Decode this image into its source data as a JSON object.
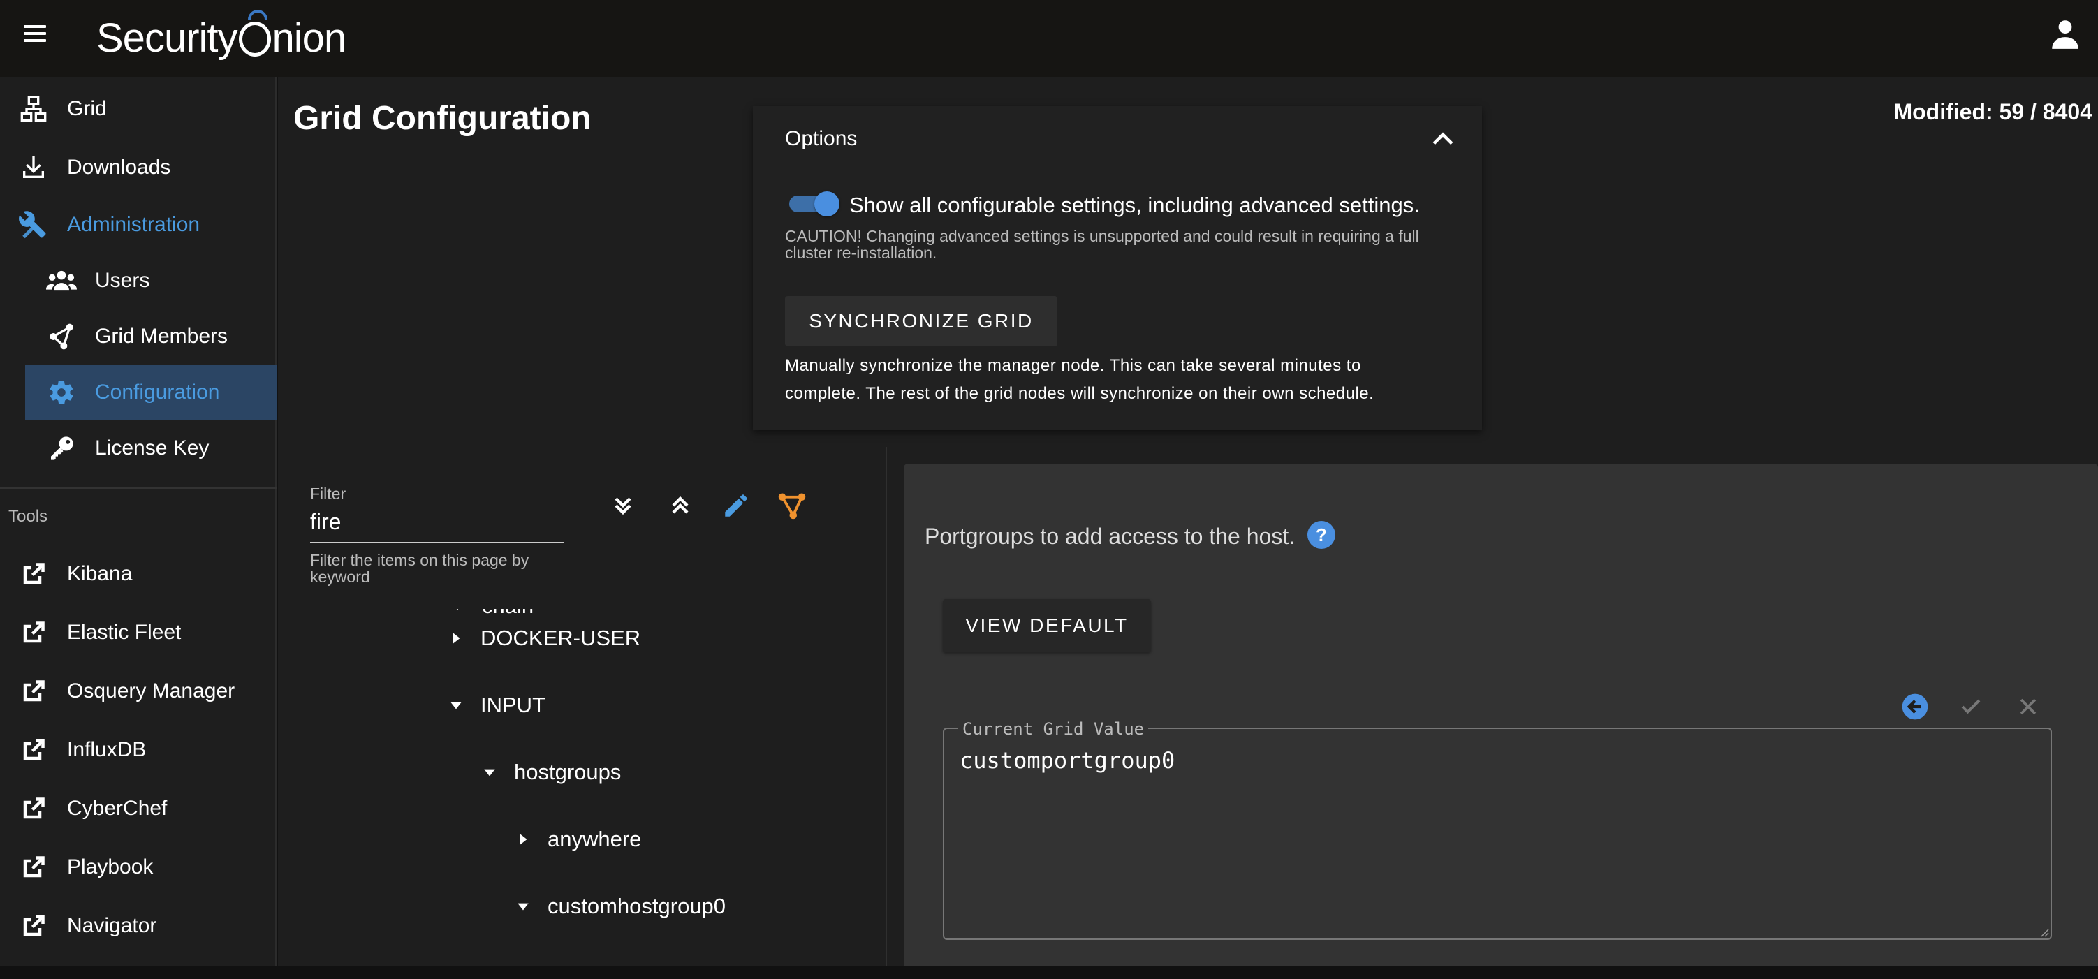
{
  "app": {
    "logo_text_a": "Security",
    "logo_text_b": "nion"
  },
  "sidebar": {
    "items": [
      {
        "label": "Grid",
        "icon": "network-icon"
      },
      {
        "label": "Downloads",
        "icon": "download-icon"
      },
      {
        "label": "Administration",
        "icon": "tools-icon"
      },
      {
        "label": "Users",
        "icon": "users-icon"
      },
      {
        "label": "Grid Members",
        "icon": "grid-members-icon"
      },
      {
        "label": "Configuration",
        "icon": "gear-icon"
      },
      {
        "label": "License Key",
        "icon": "key-icon"
      }
    ],
    "tools_label": "Tools",
    "tools": [
      {
        "label": "Kibana",
        "icon": "external-link-icon"
      },
      {
        "label": "Elastic Fleet",
        "icon": "external-link-icon"
      },
      {
        "label": "Osquery Manager",
        "icon": "external-link-icon"
      },
      {
        "label": "InfluxDB",
        "icon": "external-link-icon"
      },
      {
        "label": "CyberChef",
        "icon": "external-link-icon"
      },
      {
        "label": "Playbook",
        "icon": "external-link-icon"
      },
      {
        "label": "Navigator",
        "icon": "external-link-icon"
      }
    ]
  },
  "main": {
    "title": "Grid Configuration",
    "modified": "Modified: 59 / 8404"
  },
  "options": {
    "title": "Options",
    "toggle_on": true,
    "toggle_label": "Show all configurable settings, including advanced settings.",
    "caution": "CAUTION! Changing advanced settings is unsupported and could result in requiring a full cluster re-installation.",
    "sync_button": "SYNCHRONIZE GRID",
    "sync_desc": "Manually synchronize the manager node. This can take several minutes to complete. The rest of the grid nodes will synchronize on their own schedule."
  },
  "filter": {
    "label": "Filter",
    "value": "fire",
    "hint": "Filter the items on this page by keyword"
  },
  "tree": {
    "items": [
      {
        "label": "chain",
        "expanded": true
      },
      {
        "label": "DOCKER-USER",
        "expanded": false
      },
      {
        "label": "INPUT",
        "expanded": true
      },
      {
        "label": "hostgroups",
        "expanded": true
      },
      {
        "label": "anywhere",
        "expanded": false
      },
      {
        "label": "customhostgroup0",
        "expanded": true
      }
    ]
  },
  "detail": {
    "description": "Portgroups to add access to the host.",
    "view_default": "VIEW DEFAULT",
    "value_legend": "Current Grid Value",
    "value": "customportgroup0"
  },
  "colors": {
    "accent": "#4a9be0",
    "orange": "#f0922e",
    "selected_bg": "#2b4564"
  }
}
